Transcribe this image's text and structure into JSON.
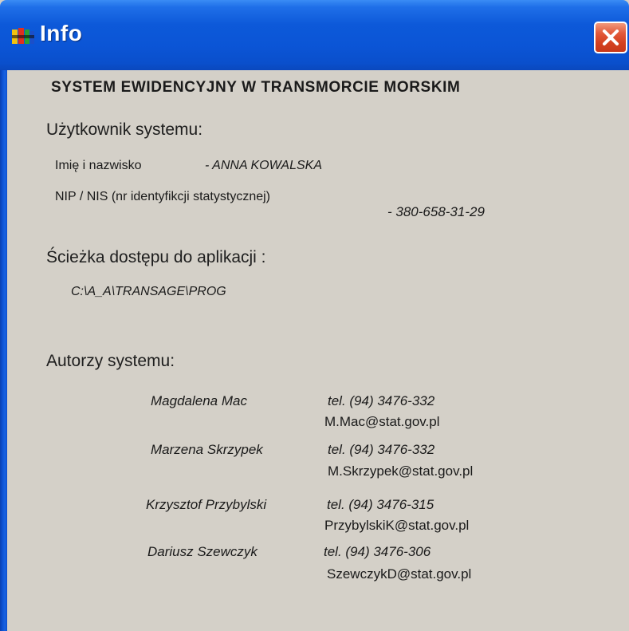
{
  "window": {
    "title": "Info",
    "icon": "app-icon",
    "close_icon": "close-icon",
    "colors": {
      "title_bar": "#0b55d6",
      "close_button": "#d4401f",
      "client_bg": "#d4d0c8"
    }
  },
  "content": {
    "system_title": "SYSTEM  EWIDENCYJNY  W  TRANSMORCIE  MORSKIM",
    "user_section_label": "Użytkownik systemu:",
    "name_label": "Imię i nazwisko",
    "name_value": "-  ANNA KOWALSKA",
    "nip_label": "NIP / NIS (nr identyfikcji statystycznej)",
    "nip_value": "-  380-658-31-29",
    "path_label": "Ścieżka dostępu do aplikacji :",
    "path_value": "C:\\A_A\\TRANSAGE\\PROG",
    "authors_label": "Autorzy systemu:",
    "authors": [
      {
        "name": "Magdalena  Mac",
        "phone": "tel. (94) 3476-332",
        "email": "M.Mac@stat.gov.pl"
      },
      {
        "name": "Marzena Skrzypek",
        "phone": "tel. (94) 3476-332",
        "email": "M.Skrzypek@stat.gov.pl"
      },
      {
        "name": "Krzysztof Przybylski",
        "phone": "tel. (94) 3476-315",
        "email": "PrzybylskiK@stat.gov.pl"
      },
      {
        "name": "Dariusz Szewczyk",
        "phone": "tel. (94) 3476-306",
        "email": "SzewczykD@stat.gov.pl"
      }
    ]
  }
}
